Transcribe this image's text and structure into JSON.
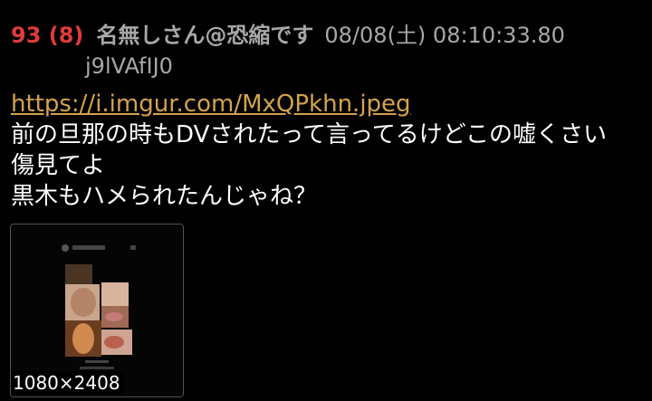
{
  "post": {
    "number": "93",
    "reply_count": "(8)",
    "name": "名無しさん@恐縮です",
    "datetime": "08/08(土) 08:10:33.80",
    "id": "j9lVAfIJ0",
    "link": "https://i.imgur.com/MxQPkhn.jpeg",
    "lines": [
      "前の旦那の時もDVされたって言ってるけどこの嘘くさい",
      "傷見てよ",
      "黒木もハメられたんじゃね？"
    ],
    "thumbnail": {
      "dimensions": "1080×2408"
    }
  },
  "colors": {
    "background": "#000000",
    "post_number": "#e03c3c",
    "meta_text": "#a8a8a8",
    "link": "#d4a24c",
    "body_text": "#ffffff"
  }
}
